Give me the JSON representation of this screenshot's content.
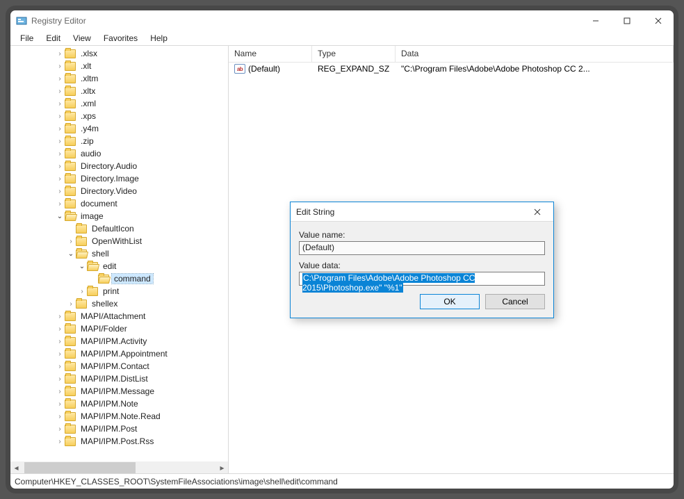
{
  "window": {
    "title": "Registry Editor"
  },
  "menu": {
    "items": [
      "File",
      "Edit",
      "View",
      "Favorites",
      "Help"
    ]
  },
  "tree": {
    "items": [
      {
        "depth": 4,
        "twisty": "closed",
        "open": false,
        "label": ".xlsx"
      },
      {
        "depth": 4,
        "twisty": "closed",
        "open": false,
        "label": ".xlt"
      },
      {
        "depth": 4,
        "twisty": "closed",
        "open": false,
        "label": ".xltm"
      },
      {
        "depth": 4,
        "twisty": "closed",
        "open": false,
        "label": ".xltx"
      },
      {
        "depth": 4,
        "twisty": "closed",
        "open": false,
        "label": ".xml"
      },
      {
        "depth": 4,
        "twisty": "closed",
        "open": false,
        "label": ".xps"
      },
      {
        "depth": 4,
        "twisty": "closed",
        "open": false,
        "label": ".y4m"
      },
      {
        "depth": 4,
        "twisty": "closed",
        "open": false,
        "label": ".zip"
      },
      {
        "depth": 4,
        "twisty": "closed",
        "open": false,
        "label": "audio"
      },
      {
        "depth": 4,
        "twisty": "closed",
        "open": false,
        "label": "Directory.Audio"
      },
      {
        "depth": 4,
        "twisty": "closed",
        "open": false,
        "label": "Directory.Image"
      },
      {
        "depth": 4,
        "twisty": "closed",
        "open": false,
        "label": "Directory.Video"
      },
      {
        "depth": 4,
        "twisty": "closed",
        "open": false,
        "label": "document"
      },
      {
        "depth": 4,
        "twisty": "open",
        "open": true,
        "label": "image"
      },
      {
        "depth": 5,
        "twisty": "none",
        "open": false,
        "label": "DefaultIcon"
      },
      {
        "depth": 5,
        "twisty": "closed",
        "open": false,
        "label": "OpenWithList"
      },
      {
        "depth": 5,
        "twisty": "open",
        "open": true,
        "label": "shell"
      },
      {
        "depth": 6,
        "twisty": "open",
        "open": true,
        "label": "edit"
      },
      {
        "depth": 7,
        "twisty": "none",
        "open": true,
        "label": "command",
        "selected": true
      },
      {
        "depth": 6,
        "twisty": "closed",
        "open": false,
        "label": "print"
      },
      {
        "depth": 5,
        "twisty": "closed",
        "open": false,
        "label": "shellex"
      },
      {
        "depth": 4,
        "twisty": "closed",
        "open": false,
        "label": "MAPI/Attachment"
      },
      {
        "depth": 4,
        "twisty": "closed",
        "open": false,
        "label": "MAPI/Folder"
      },
      {
        "depth": 4,
        "twisty": "closed",
        "open": false,
        "label": "MAPI/IPM.Activity"
      },
      {
        "depth": 4,
        "twisty": "closed",
        "open": false,
        "label": "MAPI/IPM.Appointment"
      },
      {
        "depth": 4,
        "twisty": "closed",
        "open": false,
        "label": "MAPI/IPM.Contact"
      },
      {
        "depth": 4,
        "twisty": "closed",
        "open": false,
        "label": "MAPI/IPM.DistList"
      },
      {
        "depth": 4,
        "twisty": "closed",
        "open": false,
        "label": "MAPI/IPM.Message"
      },
      {
        "depth": 4,
        "twisty": "closed",
        "open": false,
        "label": "MAPI/IPM.Note"
      },
      {
        "depth": 4,
        "twisty": "closed",
        "open": false,
        "label": "MAPI/IPM.Note.Read"
      },
      {
        "depth": 4,
        "twisty": "closed",
        "open": false,
        "label": "MAPI/IPM.Post"
      },
      {
        "depth": 4,
        "twisty": "closed",
        "open": false,
        "label": "MAPI/IPM.Post.Rss"
      }
    ]
  },
  "list": {
    "headers": {
      "name": "Name",
      "type": "Type",
      "data": "Data"
    },
    "rows": [
      {
        "name": "(Default)",
        "type": "REG_EXPAND_SZ",
        "data": "\"C:\\Program Files\\Adobe\\Adobe Photoshop CC 2..."
      }
    ]
  },
  "statusbar": {
    "path": "Computer\\HKEY_CLASSES_ROOT\\SystemFileAssociations\\image\\shell\\edit\\command"
  },
  "dialog": {
    "title": "Edit String",
    "value_name_label": "Value name:",
    "value_name": "(Default)",
    "value_data_label": "Value data:",
    "value_data": "C:\\Program Files\\Adobe\\Adobe Photoshop CC 2015\\Photoshop.exe\" \"%1\"",
    "ok": "OK",
    "cancel": "Cancel"
  },
  "icons": {
    "ab": "ab"
  }
}
